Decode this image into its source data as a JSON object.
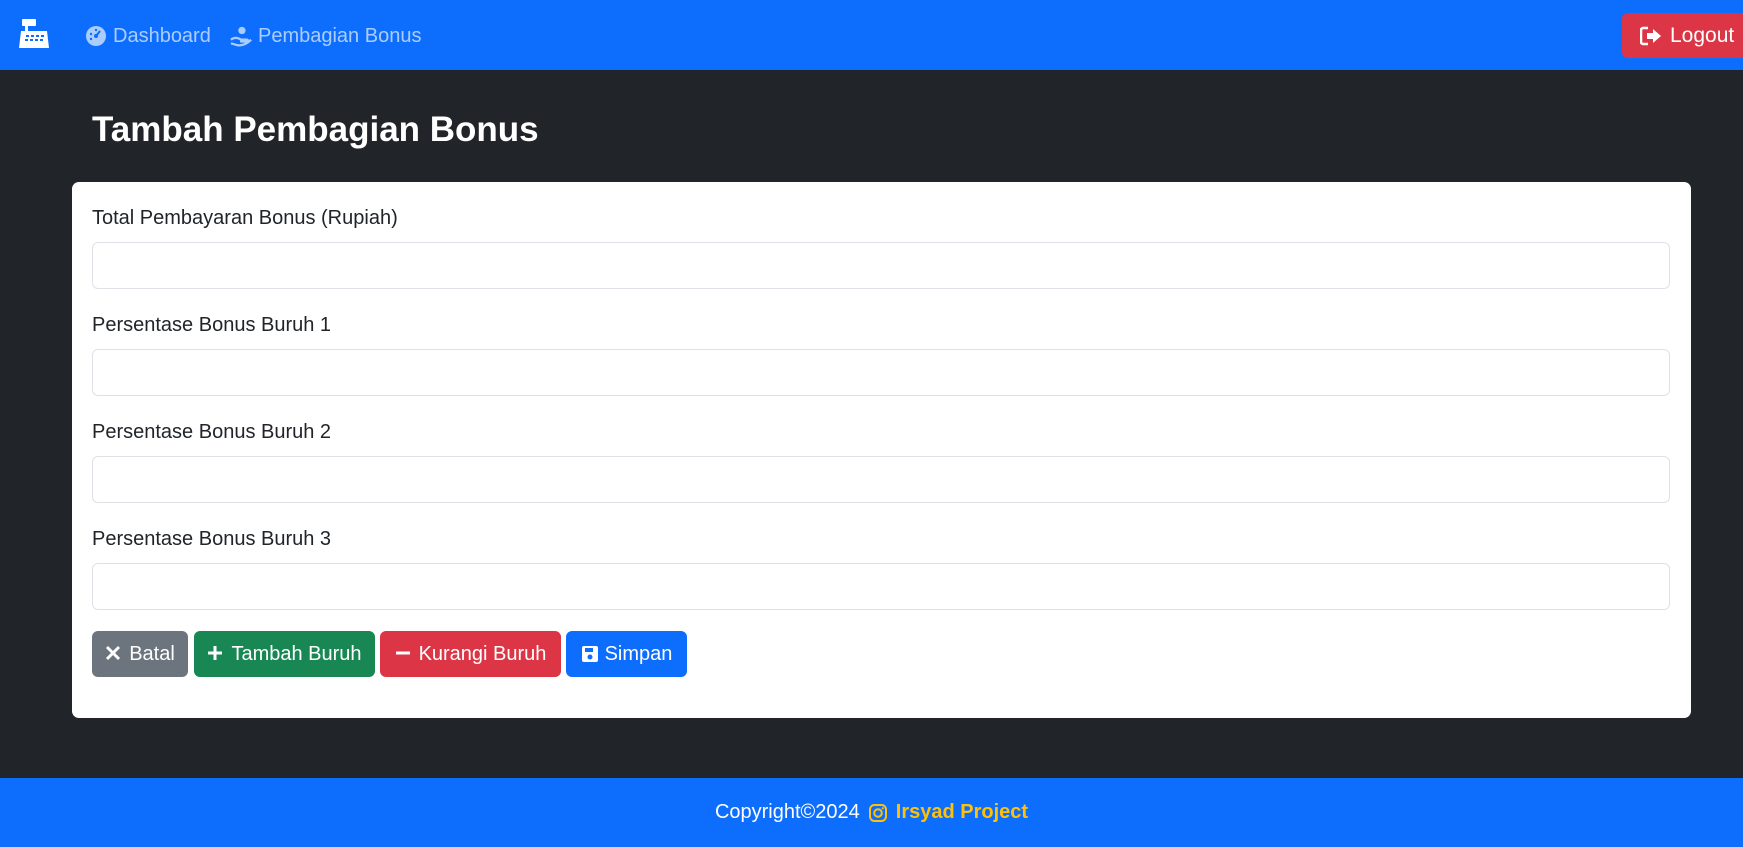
{
  "navbar": {
    "brand_icon": "cash-register-icon",
    "items": [
      {
        "label": "Dashboard",
        "icon": "dashboard-gauge-icon"
      },
      {
        "label": "Pembagian Bonus",
        "icon": "hand-coin-icon"
      }
    ],
    "logout_label": "Logout",
    "logout_icon": "logout-arrow-icon"
  },
  "page": {
    "title": "Tambah Pembagian Bonus"
  },
  "form": {
    "fields": [
      {
        "label": "Total Pembayaran Bonus (Rupiah)",
        "value": "",
        "placeholder": ""
      },
      {
        "label": "Persentase Bonus Buruh 1",
        "value": "",
        "placeholder": ""
      },
      {
        "label": "Persentase Bonus Buruh 2",
        "value": "",
        "placeholder": ""
      },
      {
        "label": "Persentase Bonus Buruh 3",
        "value": "",
        "placeholder": ""
      }
    ],
    "buttons": {
      "batal": "Batal",
      "tambah": "Tambah Buruh",
      "kurangi": "Kurangi Buruh",
      "simpan": "Simpan"
    }
  },
  "footer": {
    "copyright": "Copyright©2024",
    "brand": "Irsyad Project",
    "icon": "instagram-icon"
  },
  "colors": {
    "primary": "#0d6efd",
    "danger": "#dc3545",
    "success": "#198754",
    "secondary": "#6c757d",
    "warning": "#ffc107",
    "background": "#212529"
  }
}
